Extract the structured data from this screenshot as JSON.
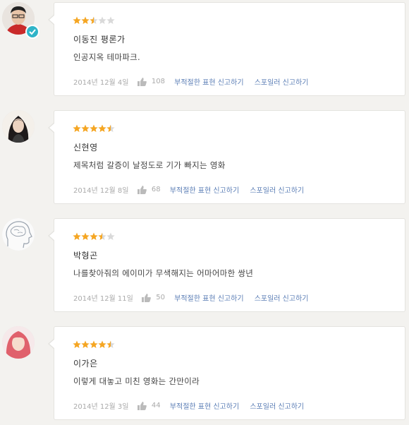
{
  "reviews": [
    {
      "author": "이동진 평론가",
      "content": "인공지옥 테마파크.",
      "date": "2014년 12월 4일",
      "likes": "108",
      "rating": 2.5,
      "verified": true,
      "avatar": "person-with-glasses-red-shirt"
    },
    {
      "author": "신현영",
      "content": "제목처럼 갈증이 날정도로 기가 빠지는 영화",
      "date": "2014년 12월 8일",
      "likes": "68",
      "rating": 4.5,
      "verified": false,
      "avatar": "woman-long-dark-hair"
    },
    {
      "author": "박형곤",
      "content": "나를찾아줘의 에이미가 무색해지는 어마어마한 쌍년",
      "date": "2014년 12월 11일",
      "likes": "50",
      "rating": 3.5,
      "verified": false,
      "avatar": "brain-head-sketch"
    },
    {
      "author": "이가은",
      "content": "이렇게 대놓고 미친 영화는 간만이라",
      "date": "2014년 12월 3일",
      "likes": "44",
      "rating": 4.5,
      "verified": false,
      "avatar": "woman-pink-hair"
    }
  ],
  "actions": {
    "report": "부적절한 표현 신고하기",
    "spoiler": "스포일러 신고하기"
  },
  "colors": {
    "star_on": "#f5a623",
    "star_off": "#d9d9d9",
    "link": "#5a7db5",
    "badge": "#2fb4c8"
  }
}
